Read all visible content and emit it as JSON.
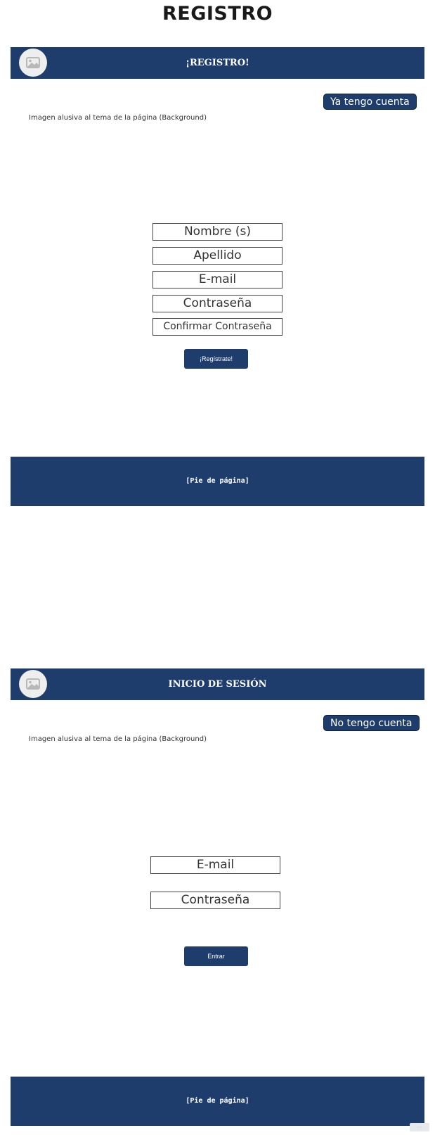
{
  "page_title": "REGISTRO",
  "registro": {
    "header_title": "¡REGISTRO!",
    "account_button": "Ya tengo cuenta",
    "background_note": "Imagen alusiva al tema de la página (Background)",
    "fields": {
      "name": "Nombre (s)",
      "lastname": "Apellido",
      "email": "E-mail",
      "password": "Contraseña",
      "confirm_password": "Confirmar Contraseña"
    },
    "submit_label": "¡Regístrate!",
    "footer_label": "[Pie de página]"
  },
  "login": {
    "header_title": "INICIO DE SESIÓN",
    "account_button": "No tengo cuenta",
    "background_note": "Imagen alusiva al tema de la página (Background)",
    "fields": {
      "email": "E-mail",
      "password": "Contraseña"
    },
    "submit_label": "Entrar",
    "footer_label": "[Pie de página]"
  },
  "icons": {
    "header_avatar": "image-placeholder-icon"
  },
  "colors": {
    "primary": "#1e3d6d",
    "avatar_bg": "#eeeeee",
    "text_on_primary": "#ffffff"
  }
}
